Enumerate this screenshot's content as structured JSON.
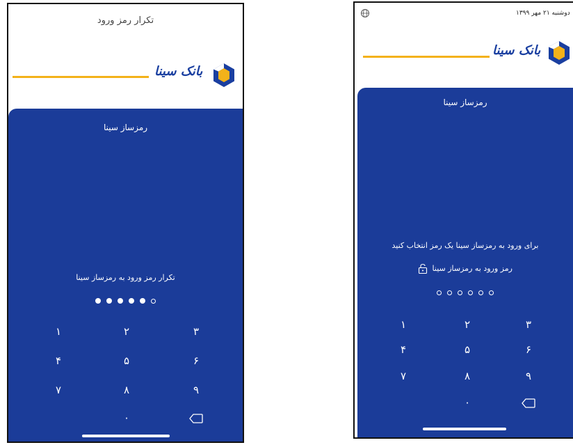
{
  "left_screen": {
    "title": "تکرار رمز ورود",
    "brand": "بانک سینا",
    "panel_title": "رمزساز سینا",
    "prompt": "تکرار رمز ورود به رمزساز سینا",
    "pin_filled": 5,
    "pin_total": 6,
    "keys": [
      "۱",
      "۲",
      "۳",
      "۴",
      "۵",
      "۶",
      "۷",
      "۸",
      "۹",
      "۰"
    ]
  },
  "right_screen": {
    "status_date": "دوشنبه ۲۱ مهر ۱۳۹۹",
    "brand": "بانک سینا",
    "panel_title": "رمزساز سینا",
    "instruction": "برای ورود به رمزساز سینا یک رمز انتخاب کنید",
    "field_label": "رمز ورود به رمزساز سینا",
    "pin_filled": 0,
    "pin_total": 6,
    "keys": [
      "۱",
      "۲",
      "۳",
      "۴",
      "۵",
      "۶",
      "۷",
      "۸",
      "۹",
      "۰"
    ]
  },
  "colors": {
    "panel_blue": "#1b3c99",
    "accent_gold": "#f3b21a",
    "brand_blue": "#1a3fa0"
  },
  "icons": {
    "status": "globe-icon",
    "delete": "backspace-icon",
    "lock": "lock-icon"
  }
}
